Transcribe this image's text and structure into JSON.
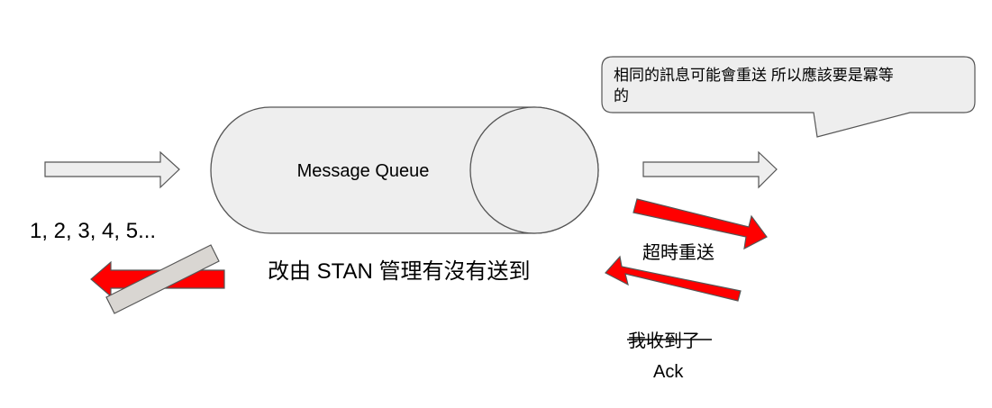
{
  "queue": {
    "label": "Message Queue"
  },
  "callout": {
    "line1": "相同的訊息可能會重送 所以應該要是冪等",
    "line2": "的"
  },
  "labels": {
    "sequence": "1, 2, 3, 4, 5...",
    "stan": "改由 STAN 管理有沒有送到",
    "timeout_resend": "超時重送",
    "received_struck": "我收到了",
    "ack": "Ack"
  },
  "colors": {
    "shape_fill": "#eeeeee",
    "shape_stroke": "#555555",
    "callout_fill": "#eeeeee",
    "red_arrow": "#ff0000",
    "blocker_fill": "#d9d6d2"
  }
}
